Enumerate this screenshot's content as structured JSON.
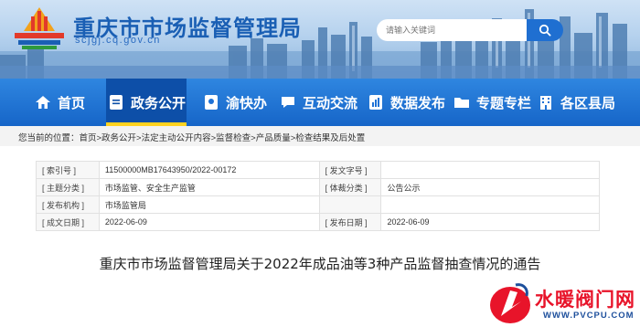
{
  "header": {
    "site_title": "重庆市市场监督管理局",
    "site_url": "scjgj.cq.gov.cn",
    "search_placeholder": "请输入关键词"
  },
  "nav": {
    "items": [
      {
        "label": "首页",
        "icon": "home-icon"
      },
      {
        "label": "政务公开",
        "icon": "document-icon",
        "active": true
      },
      {
        "label": "渝快办",
        "icon": "badge-icon"
      },
      {
        "label": "互动交流",
        "icon": "chat-icon"
      },
      {
        "label": "数据发布",
        "icon": "data-icon"
      },
      {
        "label": "专题专栏",
        "icon": "folder-icon"
      },
      {
        "label": "各区县局",
        "icon": "building-icon"
      }
    ]
  },
  "breadcrumb": "您当前的位置：首页>政务公开>法定主动公开内容>监督检查>产品质量>检查结果及后处置",
  "info": {
    "index_label": "[ 索引号 ]",
    "index_value": "11500000MB17643950/2022-00172",
    "docno_label": "[ 发文字号 ]",
    "docno_value": "",
    "topic_label": "[ 主题分类 ]",
    "topic_value": "市场监管、安全生产监管",
    "genre_label": "[ 体裁分类 ]",
    "genre_value": "公告公示",
    "issuer_label": "[ 发布机构 ]",
    "issuer_value": "市场监管局",
    "created_label": "[ 成文日期 ]",
    "created_value": "2022-06-09",
    "published_label": "[ 发布日期 ]",
    "published_value": "2022-06-09"
  },
  "doc_title": "重庆市市场监督管理局关于2022年成品油等3种产品监督抽查情况的通告",
  "watermark": {
    "text": "水暖阀门网",
    "url": "WWW.PVCPU.COM"
  },
  "colors": {
    "nav_blue": "#1f72d6",
    "nav_active": "#0d4fa8",
    "active_marker": "#ffd21f",
    "title_blue": "#1a5fb4",
    "watermark_red": "#e8142a"
  }
}
